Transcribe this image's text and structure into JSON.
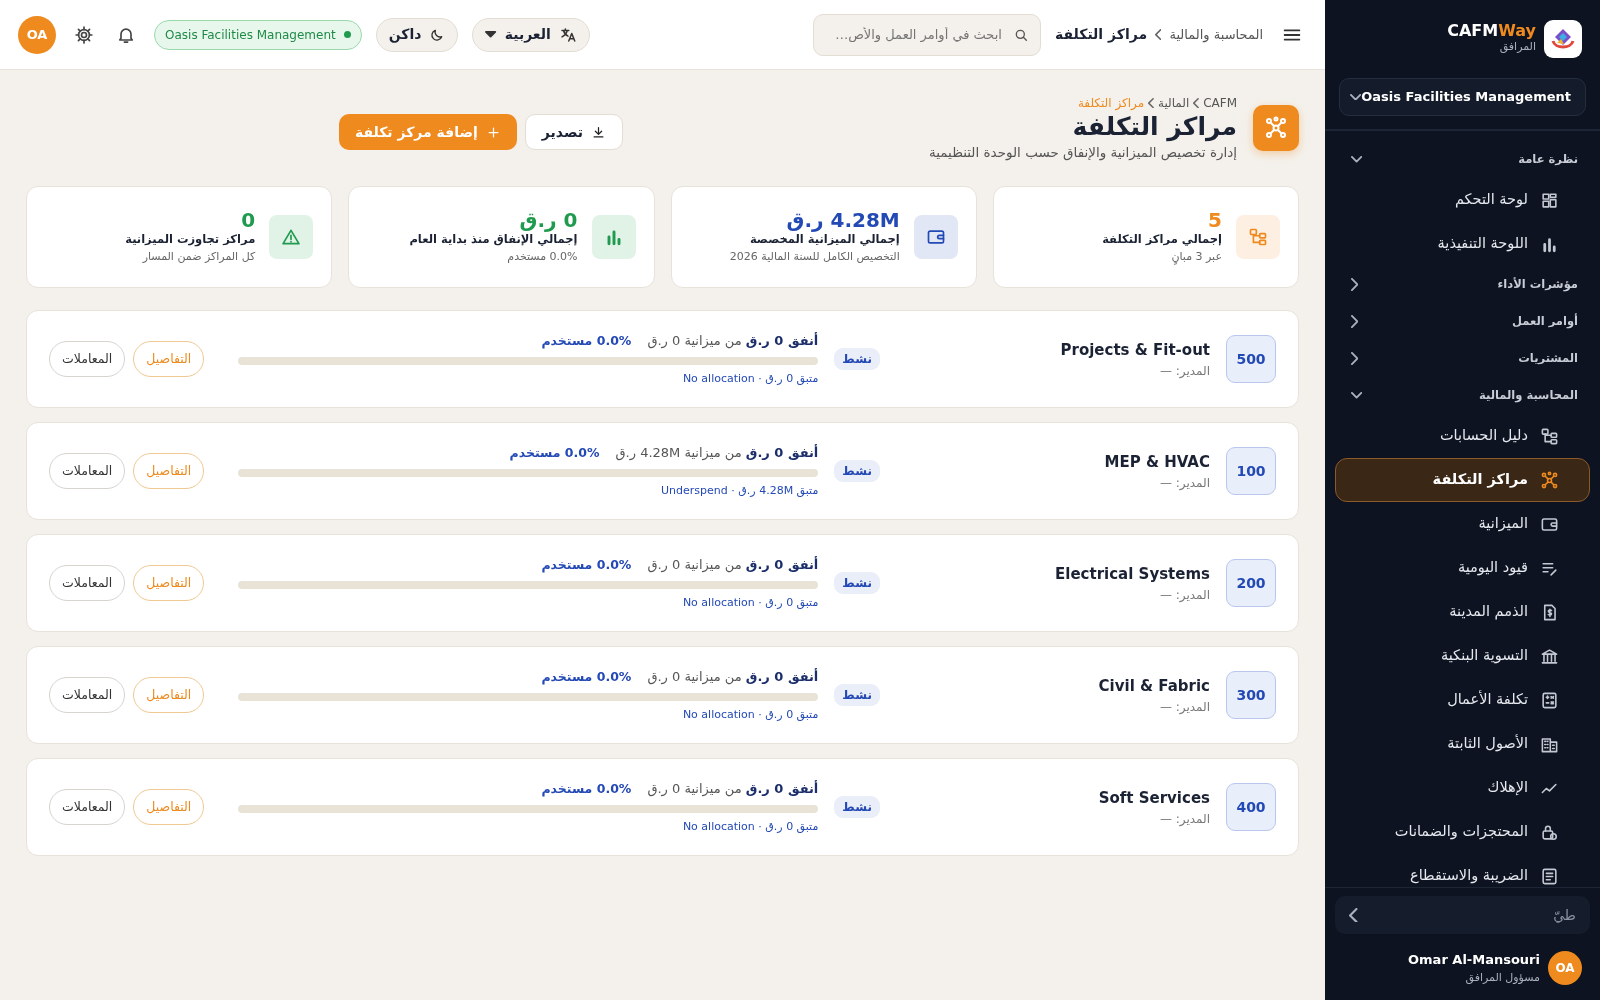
{
  "topbar": {
    "breadcrumb": [
      "المحاسبة والمالية",
      "مراكز التكلفة"
    ],
    "search": {
      "placeholder": "ابحث في أوامر العمل والأص…"
    },
    "language": "العربية",
    "theme": "داكن",
    "organization": "Oasis Facilities Management",
    "avatar": "OA"
  },
  "page": {
    "breadcrumb": [
      "CAFM",
      "المالية",
      "مراكز التكلفة"
    ],
    "title": "مراكز التكلفة",
    "subtitle": "إدارة تخصيص الميزانية والإنفاق حسب الوحدة التنظيمية",
    "buttons": [
      {
        "kind": "outline",
        "label": "تصدير"
      },
      {
        "kind": "primary",
        "label": "إضافة مركز تكلفة"
      }
    ]
  },
  "stats": [
    {
      "kind": "hierarchy",
      "color": "#ee8a1e",
      "value": "5",
      "label": "إجمالي مراكز التكلفة",
      "sub": "عبر 3 مبانٍ"
    },
    {
      "kind": "wallet",
      "color": "#2349b5",
      "value": "4.28M ر.ق",
      "label": "إجمالي الميزانية المخصصة",
      "sub": "التخصيص الكامل للسنة المالية 2026"
    },
    {
      "kind": "chart",
      "color": "#1f9a4e",
      "value": "0 ر.ق",
      "label": "إجمالي الإنفاق منذ بداية العام",
      "sub": "0.0% مستخدم"
    },
    {
      "kind": "warning",
      "color": "#1f9a4e",
      "value": "0",
      "label": "مراكز تجاوزت الميزانية",
      "sub": "كل المراكز ضمن المسار"
    }
  ],
  "cost_centers": [
    {
      "code": "500",
      "name": "Projects & Fit-out",
      "manager": "المدير: —",
      "status": "نشط",
      "spent": "**أنفق 0 ر.ق** من ميزانية 0 ر.ق",
      "used": "0.0% مستخدم",
      "level": 0,
      "remaining": "متبق 0 ر.ق · No allocation",
      "buttons": [
        "التفاصيل",
        "المعاملات"
      ]
    },
    {
      "code": "100",
      "name": "MEP & HVAC",
      "manager": "المدير: —",
      "status": "نشط",
      "spent": "**أنفق 0 ر.ق** من ميزانية 4.28M ر.ق",
      "used": "0.0% مستخدم",
      "level": 0,
      "remaining": "متبق 4.28M ر.ق · Underspend",
      "buttons": [
        "التفاصيل",
        "المعاملات"
      ]
    },
    {
      "code": "200",
      "name": "Electrical Systems",
      "manager": "المدير: —",
      "status": "نشط",
      "spent": "**أنفق 0 ر.ق** من ميزانية 0 ر.ق",
      "used": "0.0% مستخدم",
      "level": 0,
      "remaining": "متبق 0 ر.ق · No allocation",
      "buttons": [
        "التفاصيل",
        "المعاملات"
      ]
    },
    {
      "code": "300",
      "name": "Civil & Fabric",
      "manager": "المدير: —",
      "status": "نشط",
      "spent": "**أنفق 0 ر.ق** من ميزانية 0 ر.ق",
      "used": "0.0% مستخدم",
      "level": 0,
      "remaining": "متبق 0 ر.ق · No allocation",
      "buttons": [
        "التفاصيل",
        "المعاملات"
      ]
    },
    {
      "code": "400",
      "name": "Soft Services",
      "manager": "المدير: —",
      "status": "نشط",
      "spent": "**أنفق 0 ر.ق** من ميزانية 0 ر.ق",
      "used": "0.0% مستخدم",
      "level": 0,
      "remaining": "متبق 0 ر.ق · No allocation",
      "buttons": [
        "التفاصيل",
        "المعاملات"
      ]
    }
  ],
  "sidebar": {
    "brand": {
      "name_start": "CAFM",
      "name_end": "Way",
      "subtitle": "المرافق"
    },
    "organization": "Oasis Facilities Management",
    "sections": [
      {
        "label": "نظرة عامة",
        "expanded": true,
        "items": [
          {
            "label": "لوحة التحكم",
            "kind": "grid",
            "selected": false
          },
          {
            "label": "اللوحة التنفيذية",
            "kind": "bars",
            "selected": false
          }
        ]
      },
      {
        "label": "مؤشرات الأداء",
        "expanded": false
      },
      {
        "label": "أوامر العمل",
        "expanded": false
      },
      {
        "label": "المشتريات",
        "expanded": false
      },
      {
        "label": "المحاسبة والمالية",
        "expanded": true,
        "items": [
          {
            "label": "دليل الحسابات",
            "kind": "hierarchy",
            "selected": false
          },
          {
            "label": "مراكز التكلفة",
            "kind": "network",
            "selected": true
          },
          {
            "label": "الميزانية",
            "kind": "wallet",
            "selected": false
          },
          {
            "label": "قيود اليومية",
            "kind": "journal",
            "selected": false
          },
          {
            "label": "الذمم المدينة",
            "kind": "invoice",
            "selected": false
          },
          {
            "label": "التسوية البنكية",
            "kind": "bank",
            "selected": false
          },
          {
            "label": "تكلفة الأعمال",
            "kind": "calculator",
            "selected": false
          },
          {
            "label": "الأصول الثابتة",
            "kind": "building",
            "selected": false
          },
          {
            "label": "الإهلاك",
            "kind": "trend",
            "selected": false
          },
          {
            "label": "المحتجزات والضمانات",
            "kind": "lock",
            "selected": false
          },
          {
            "label": "الضريبة والاستقطاع",
            "kind": "receipt",
            "selected": false
          }
        ]
      }
    ],
    "collapse": "طيّ",
    "user": {
      "name": "Omar Al-Mansouri",
      "role": "مسؤول المرافق",
      "avatar": "OA"
    }
  }
}
